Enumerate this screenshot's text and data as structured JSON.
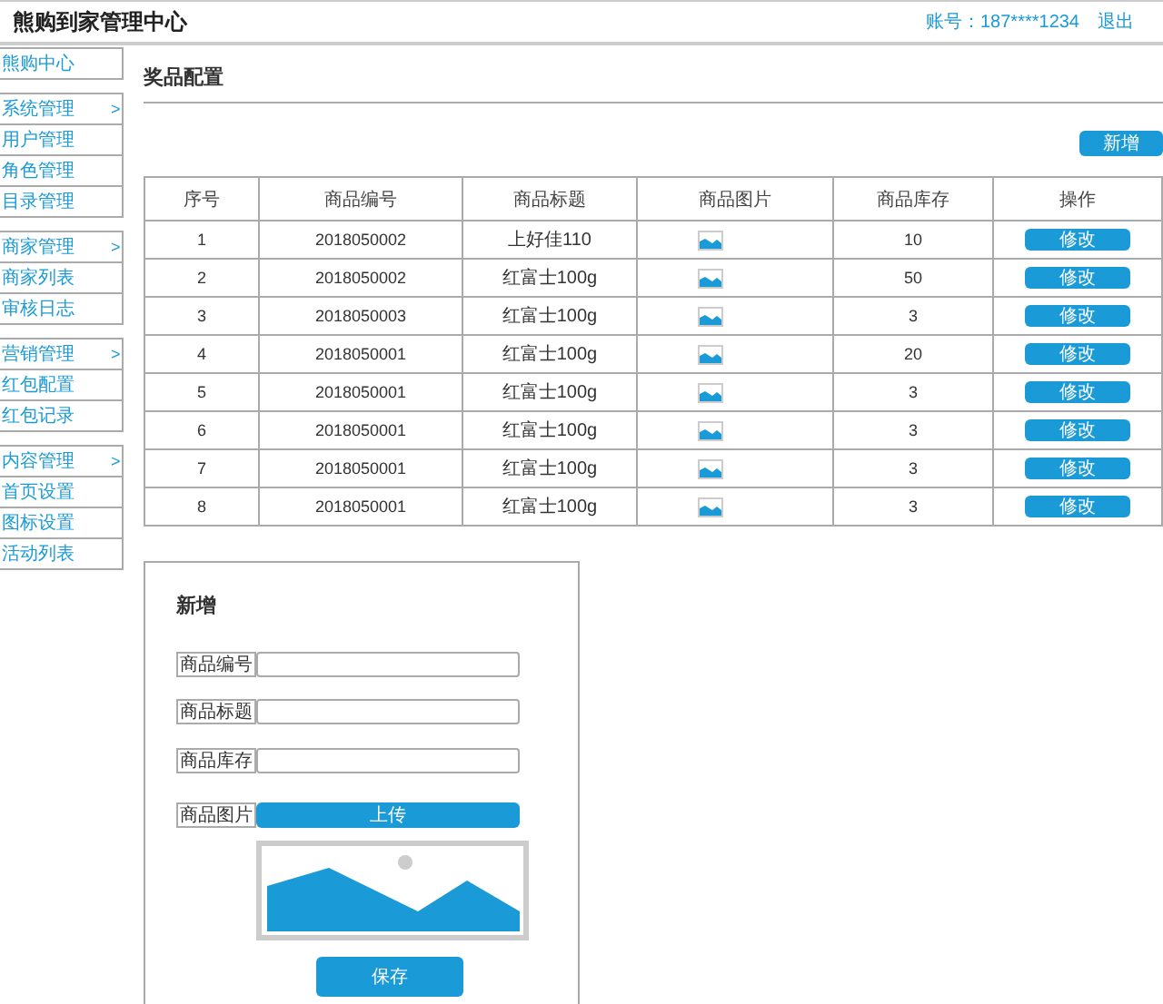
{
  "header": {
    "title": "熊购到家管理中心",
    "account": "账号：187****1234",
    "logout": "退出"
  },
  "sidebar": {
    "groups": [
      {
        "items": [
          {
            "label": "熊购中心"
          }
        ]
      },
      {
        "items": [
          {
            "label": "系统管理",
            "arrow": ">"
          },
          {
            "label": "用户管理"
          },
          {
            "label": "角色管理"
          },
          {
            "label": "目录管理"
          }
        ]
      },
      {
        "items": [
          {
            "label": "商家管理",
            "arrow": ">"
          },
          {
            "label": "商家列表"
          },
          {
            "label": "审核日志"
          }
        ]
      },
      {
        "items": [
          {
            "label": "营销管理",
            "arrow": ">"
          },
          {
            "label": "红包配置"
          },
          {
            "label": "红包记录"
          }
        ]
      },
      {
        "items": [
          {
            "label": "内容管理",
            "arrow": ">"
          },
          {
            "label": "首页设置"
          },
          {
            "label": "图标设置"
          },
          {
            "label": "活动列表"
          }
        ]
      }
    ]
  },
  "page": {
    "title": "奖品配置",
    "add_button": "新增"
  },
  "table": {
    "columns": [
      "序号",
      "商品编号",
      "商品标题",
      "商品图片",
      "商品库存",
      "操作"
    ],
    "rows": [
      {
        "index": "1",
        "code": "2018050002",
        "title": "上好佳110",
        "stock": "10",
        "action": "修改"
      },
      {
        "index": "2",
        "code": "2018050002",
        "title": "红富士100g",
        "stock": "50",
        "action": "修改"
      },
      {
        "index": "3",
        "code": "2018050003",
        "title": "红富士100g",
        "stock": "3",
        "action": "修改"
      },
      {
        "index": "4",
        "code": "2018050001",
        "title": "红富士100g",
        "stock": "20",
        "action": "修改"
      },
      {
        "index": "5",
        "code": "2018050001",
        "title": "红富士100g",
        "stock": "3",
        "action": "修改"
      },
      {
        "index": "6",
        "code": "2018050001",
        "title": "红富士100g",
        "stock": "3",
        "action": "修改"
      },
      {
        "index": "7",
        "code": "2018050001",
        "title": "红富士100g",
        "stock": "3",
        "action": "修改"
      },
      {
        "index": "8",
        "code": "2018050001",
        "title": "红富士100g",
        "stock": "3",
        "action": "修改"
      }
    ]
  },
  "form": {
    "title": "新增",
    "fields": [
      {
        "kind": "text",
        "label": "商品编号"
      },
      {
        "kind": "text",
        "label": "商品标题"
      },
      {
        "kind": "text",
        "label": "商品库存"
      },
      {
        "kind": "upload",
        "label": "商品图片",
        "button": "上传"
      }
    ],
    "save": "保存"
  }
}
